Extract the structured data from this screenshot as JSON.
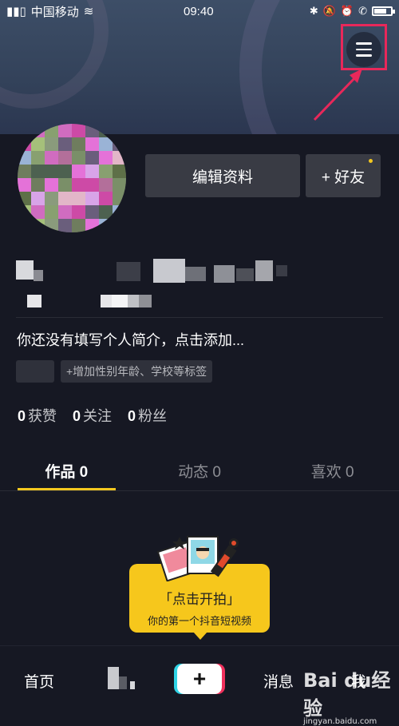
{
  "status_bar": {
    "carrier": "中国移动",
    "time": "09:40"
  },
  "profile": {
    "edit_label": "编辑资料",
    "friend_label": "+ 好友",
    "bio": "你还没有填写个人简介，点击添加...",
    "tag_add": "+增加性别年龄、学校等标签"
  },
  "stats": [
    {
      "count": "0",
      "label": "获赞"
    },
    {
      "count": "0",
      "label": "关注"
    },
    {
      "count": "0",
      "label": "粉丝"
    }
  ],
  "tabs": [
    {
      "label": "作品 0"
    },
    {
      "label": "动态 0"
    },
    {
      "label": "喜欢 0"
    }
  ],
  "prompt": {
    "title": "「点击开拍」",
    "subtitle": "你的第一个抖音短视频"
  },
  "bottom_nav": {
    "home": "首页",
    "plus": "+",
    "messages": "消息",
    "me": "我"
  },
  "watermark": {
    "main": "Bai du经验",
    "sub": "jingyan.baidu.com"
  },
  "colors": {
    "accent": "#f3c71f",
    "highlight": "#e8285a",
    "background": "#161823"
  }
}
